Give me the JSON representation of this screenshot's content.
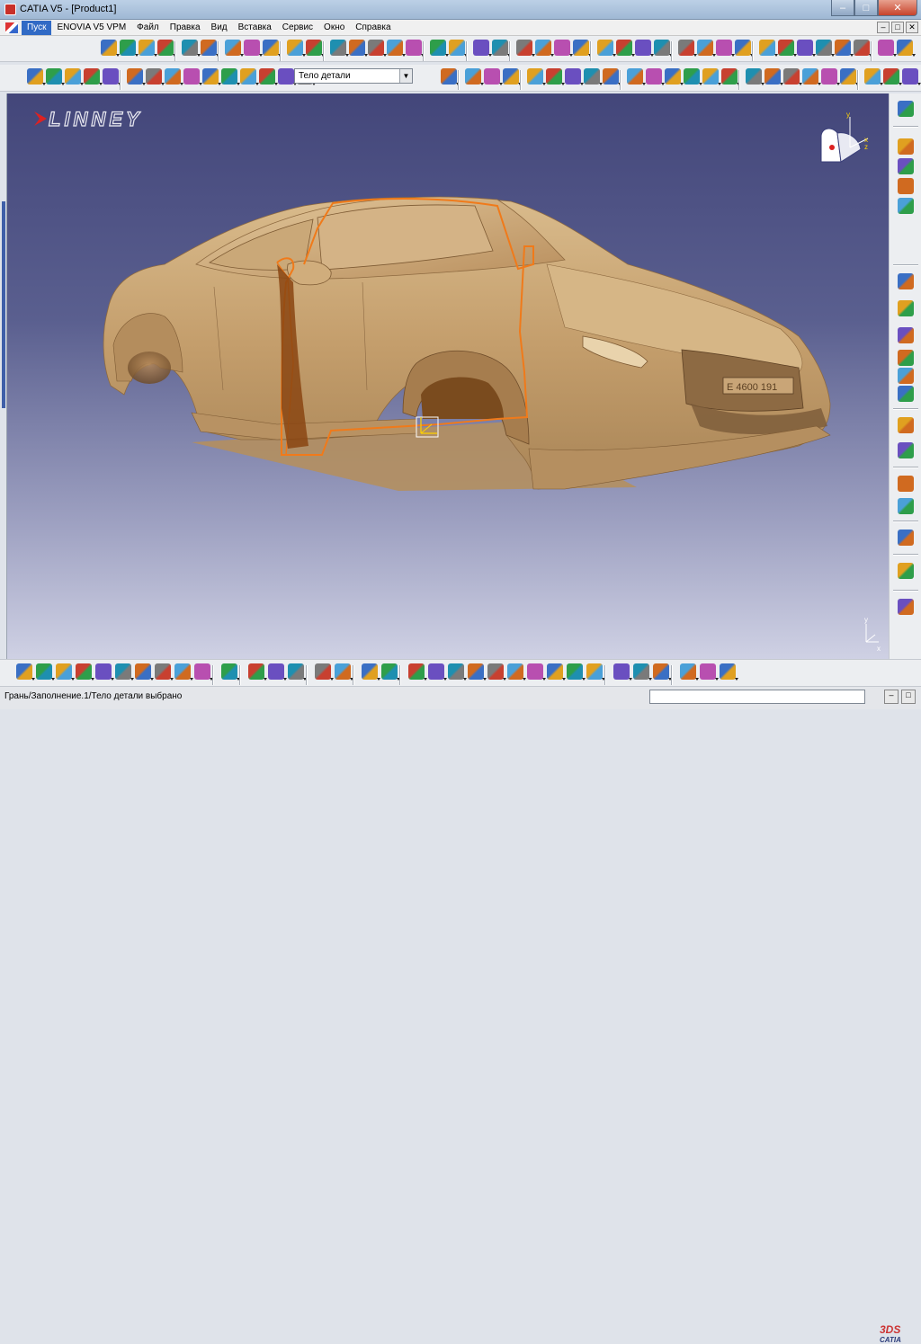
{
  "window": {
    "title": "CATIA V5 - [Product1]",
    "min": "–",
    "max": "□",
    "close": "✕"
  },
  "menu": {
    "items": [
      "Пуск",
      "ENOVIA V5 VPM",
      "Файл",
      "Правка",
      "Вид",
      "Вставка",
      "Сервис",
      "Окно",
      "Справка"
    ],
    "active_index": 0
  },
  "toolbar": {
    "selection_filter": "Тело детали",
    "selection_arrow": "▼"
  },
  "viewport": {
    "logo_text": "LINNEY",
    "plate_text": "E 4600 191",
    "compass_axes": {
      "x": "x",
      "y": "y",
      "z": "z"
    }
  },
  "statusbar": {
    "message": "Грань/Заполнение.1/Тело детали выбрано",
    "input_value": ""
  },
  "brand": {
    "ds": "3DS",
    "name": "CATIA"
  },
  "colors": {
    "titlebar": "#a9c0da",
    "viewport_top": "#43467a",
    "viewport_bottom": "#cfd1e4",
    "car_body": "#c9a678",
    "selection_edge": "#f07a1a",
    "accent_blue": "#316ac5"
  }
}
